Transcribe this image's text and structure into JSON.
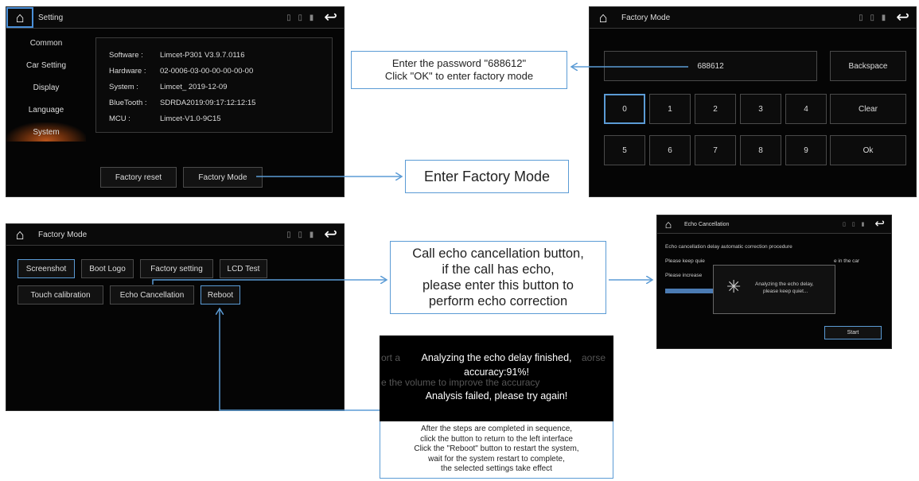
{
  "screen1": {
    "title": "Setting",
    "status_icons": "▯ ▯ ▮",
    "sidebar": [
      "Common",
      "Car Setting",
      "Display",
      "Language",
      "System"
    ],
    "info": [
      {
        "label": "Software :",
        "value": "Limcet-P301 V3.9.7.0116"
      },
      {
        "label": "Hardware :",
        "value": "02-0006-03-00-00-00-00-00"
      },
      {
        "label": "System :",
        "value": "Limcet_ 2019-12-09"
      },
      {
        "label": "BlueTooth :",
        "value": "SDRDA2019:09:17:12:12:15"
      },
      {
        "label": "MCU :",
        "value": "Limcet-V1.0-9C15"
      }
    ],
    "factory_reset": "Factory reset",
    "factory_mode": "Factory Mode"
  },
  "screen2": {
    "title": "Factory Mode",
    "status_icons": "▯ ▯ ▮",
    "password_value": "688612",
    "backspace": "Backspace",
    "keys_row1": [
      "0",
      "1",
      "2",
      "3",
      "4"
    ],
    "keys_row2": [
      "5",
      "6",
      "7",
      "8",
      "9"
    ],
    "clear": "Clear",
    "ok": "Ok"
  },
  "screen3": {
    "title": "Factory Mode",
    "status_icons": "▯ ▯ ▮",
    "buttons_row1": [
      "Screenshot",
      "Boot Logo",
      "Factory setting",
      "LCD Test"
    ],
    "buttons_row2": [
      "Touch calibration",
      "Echo Cancellation",
      "Reboot"
    ]
  },
  "screen4": {
    "title": "Echo Cancellation",
    "status_icons": "▯ ▯ ▮",
    "line1": "Echo cancellation delay automatic correction procedure",
    "line2a": "Please keep quie",
    "line2b": "e in the car",
    "line3": "Please increase",
    "dialog_line1": "Analyzing the echo delay,",
    "dialog_line2": "please keep quiet...",
    "start": "Start"
  },
  "result": {
    "line1": "Analyzing the echo delay finished,",
    "line2": "accuracy:91%!",
    "line3": "Analysis failed, please try again!",
    "ghost1": "ort a",
    "ghost2": "aorse",
    "ghost3": "e the volume to improve the accuracy"
  },
  "callouts": {
    "password_1": "Enter the password \"688612\"",
    "password_2": "Click \"OK\" to enter factory mode",
    "enter_factory": "Enter Factory Mode",
    "echo_1": "Call echo cancellation button,",
    "echo_2": "if the call has echo,",
    "echo_3": "please enter this button to",
    "echo_4": "perform echo correction",
    "steps_1": "After the steps are completed in sequence,",
    "steps_2": "click the button to return to the left interface",
    "steps_3": "Click the \"Reboot\" button to restart the system,",
    "steps_4": "wait for the system restart to complete,",
    "steps_5": "the selected settings take effect"
  },
  "colors": {
    "accent": "#5b9bd5",
    "screen_bg": "#050505",
    "active_tab_glow": "#b8551d"
  }
}
